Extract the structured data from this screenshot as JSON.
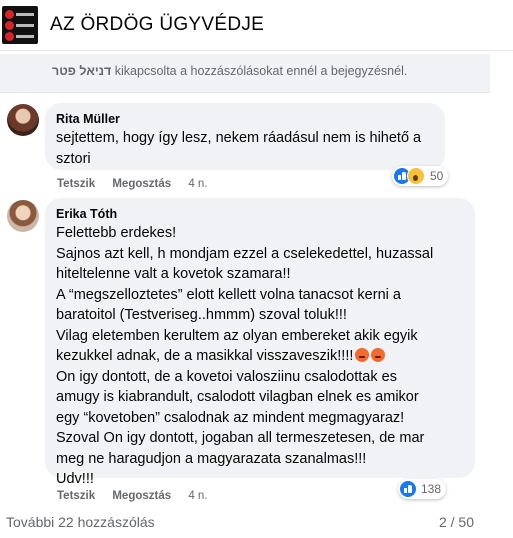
{
  "page": {
    "title": "AZ ÖRDÖG ÜGYVÉDJE"
  },
  "notice": {
    "name": "דניאל פטר",
    "text": "kikapcsolta a hozzászólásokat ennél a bejegyzésnél."
  },
  "comments": [
    {
      "author": "Rita Müller",
      "text": "sejtettem, hogy így lesz, nekem ráadásul nem is hihető a\nsztori",
      "like_label": "Tetszik",
      "share_label": "Megosztás",
      "time": "4 n.",
      "reactions": {
        "icons": [
          "like-icon",
          "wow-icon"
        ],
        "count": "50"
      }
    },
    {
      "author": "Erika Tóth",
      "text_before_emoji": "Felettebb erdekes!\nSajnos azt kell, h mondjam ezzel a cselekedettel, huzassal\nhiteltelenne valt a kovetok szamara!!\nA “megszelloztetes” elott kellett volna tanacsot kerni a\nbaratoitol (Testveriseg..hmmm) szoval toluk!!!\nVilag eletemben kerultem az olyan embereket akik egyik\nkezukkel adnak, de a masikkal visszaveszik!!!!",
      "emojis": [
        "angry-emoji",
        "angry-emoji"
      ],
      "text_after_emoji": "\nOn igy dontott, de a kovetoi valosziinu csalodottak es\namugy is kiabrandult, csalodott vilagban elnek es amikor\negy “kovetoben” csalodnak az mindent megmagyaraz!\nSzoval On igy dontott, jogaban all termeszetesen, de mar\nmeg ne haragudjon a magyarazata szanalmas!!!\nUdv!!!",
      "like_label": "Tetszik",
      "share_label": "Megosztás",
      "time": "4 n.",
      "reactions": {
        "icons": [
          "like-icon"
        ],
        "count": "138"
      }
    }
  ],
  "footer": {
    "more_comments": "További 22 hozzászólás",
    "pager": "2 / 50"
  },
  "colors": {
    "bubble": "#f0f2f5",
    "like": "#1877f2",
    "secondary_text": "#65676b"
  }
}
